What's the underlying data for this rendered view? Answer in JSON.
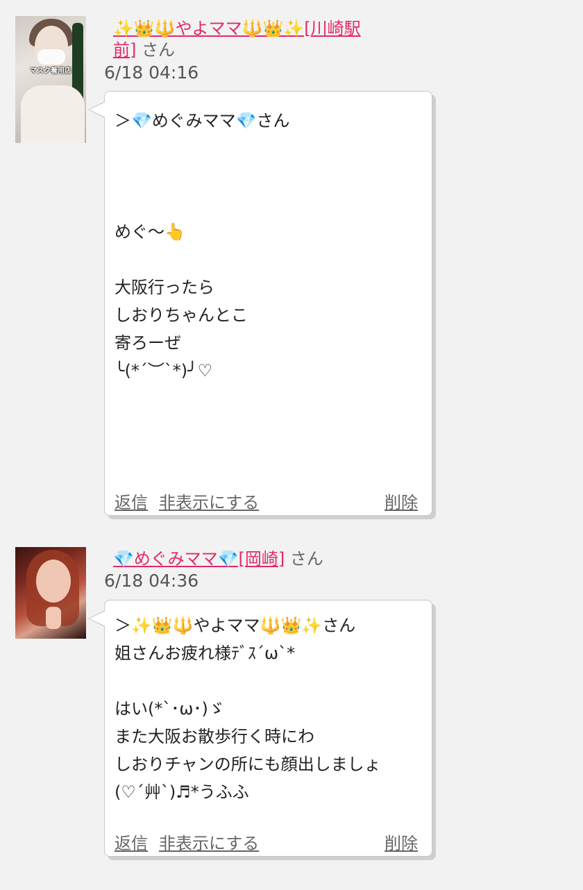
{
  "posts": [
    {
      "avatar_caption": "マスク着用店",
      "name_line1": "✨👑🔱やよママ🔱👑✨[川崎駅",
      "name_line2": "前]",
      "san": "さん",
      "date": "6/18 04:16",
      "message": "＞💎めぐみママ💎さん\n\n\n\nめぐ〜👆\n\n大阪行ったら\nしおりちゃんとこ\n寄ろーぜ\n╰(*´︶`*)╯♡",
      "reply": "返信",
      "hide": "非表示にする",
      "delete": "削除"
    },
    {
      "name_line1": "💎めぐみママ💎[岡崎]",
      "san": "さん",
      "date": "6/18 04:36",
      "message": "＞✨👑🔱やよママ🔱👑✨さん\n姐さんお疲れ様ﾃﾞｽ´ω`*\n\nはい(*`･ω･)ゞ\nまた大阪お散歩行く時にわ\nしおりチャンの所にも顔出しましょ\n(♡´艸`)♬*うふふ",
      "reply": "返信",
      "hide": "非表示にする",
      "delete": "削除"
    }
  ]
}
